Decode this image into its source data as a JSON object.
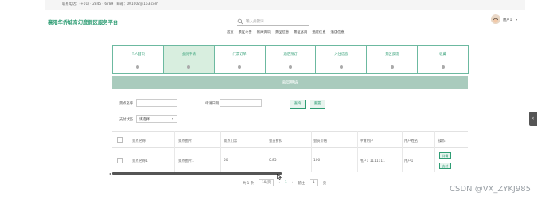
{
  "topbar": {
    "contact": "联系电话：(+01) - 2345 - 6789 | 邮箱：001002@163.com"
  },
  "header": {
    "site_title": "襄阳华侨城奇幻度假区服务平台",
    "search_placeholder": "输入关键词",
    "user_name": "用户1",
    "caret": "▾"
  },
  "nav": {
    "items": [
      "首页",
      "景区公告",
      "新闻资讯",
      "景区信息",
      "景区务列",
      "酒店信息",
      "酒店信息"
    ]
  },
  "cards": [
    {
      "label": "个人首页",
      "active": false
    },
    {
      "label": "会员申请",
      "active": true
    },
    {
      "label": "门票订单",
      "active": false
    },
    {
      "label": "酒店预订",
      "active": false
    },
    {
      "label": "入住信息",
      "active": false
    },
    {
      "label": "景区反馈",
      "active": false
    },
    {
      "label": "收藏",
      "active": false
    }
  ],
  "section": {
    "title": "会员申请"
  },
  "filters": {
    "spot_name_label": "景点名称",
    "apply_date_label": "申请日期",
    "search_btn": "查询",
    "reset_btn": "重置",
    "pay_status_label": "支付状态",
    "pay_status_value": "请选择"
  },
  "table": {
    "headers": [
      "景点名称",
      "景点图片",
      "景点门票",
      "会员折扣",
      "会员价格",
      "申请用户",
      "用户姓名",
      "操作"
    ],
    "rows": [
      {
        "name": "景点名称1",
        "image": "景点图片1",
        "ticket": "50",
        "discount": "0.85",
        "price": "100",
        "user": "用户1 1111111",
        "realname": "用户1",
        "actions": [
          "详情",
          "支付"
        ]
      }
    ]
  },
  "pager": {
    "total": "共 1 条",
    "page_size": "10/页",
    "prev": "‹",
    "page": "1",
    "next": "›",
    "goto_label": "前往",
    "goto_value": "1",
    "goto_unit": "页"
  },
  "side_tab": {
    "glyph": "‹"
  },
  "watermark": "CSDN @VX_ZYKJ985"
}
